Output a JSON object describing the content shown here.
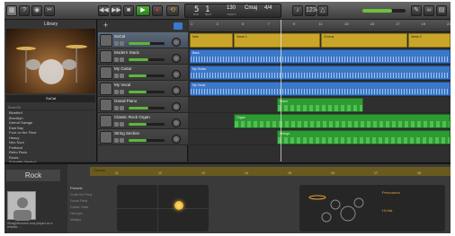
{
  "toolbar": {
    "lcd": {
      "bar": "5",
      "beat": "1",
      "tempo": "130",
      "key": "Cmaj",
      "time_sig": "4/4",
      "bar_caption": "BAR",
      "beat_caption": "BEAT",
      "tempo_caption": "TEMPO"
    }
  },
  "library": {
    "title": "Library",
    "selected_name": "SoCal",
    "section": "Drum Kit",
    "items": [
      "Bluebird",
      "Brooklyn",
      "Detroit Garage",
      "East Bay",
      "Four on the Floor",
      "Heavy",
      "Neo Soul",
      "Portland",
      "Retro Rock",
      "Roots",
      "Scientific Method",
      "Slow Jam",
      "Smash",
      "SoCal",
      "Sunset"
    ],
    "selected_index": 13
  },
  "tracks": [
    {
      "name": "SoCal",
      "volume": 0.6,
      "selected": true
    },
    {
      "name": "Modern Stack",
      "volume": 0.55
    },
    {
      "name": "My Guitar",
      "volume": 0.5
    },
    {
      "name": "My Vocal",
      "volume": 0.5
    },
    {
      "name": "Grand Piano",
      "volume": 0.55
    },
    {
      "name": "Classic Rock Organ",
      "volume": 0.5
    },
    {
      "name": "String Section",
      "volume": 0.5
    }
  ],
  "ruler": [
    "1",
    "3",
    "5",
    "7",
    "9",
    "11",
    "13",
    "15",
    "17",
    "19",
    "21"
  ],
  "regions": {
    "intro": "Intro",
    "verse1": "Verse 1",
    "chorus": "Chorus",
    "verse2": "Verse 2",
    "bass": "Bass",
    "guitar": "My Guitar",
    "vocal": "My Vocal",
    "piano": "Piano",
    "organ": "Organ",
    "strings": "Strings"
  },
  "editor": {
    "instrument": "Rock",
    "region_label": "Chorus",
    "ruler": [
      "11",
      "12",
      "13",
      "14",
      "15",
      "16",
      "17",
      "18"
    ],
    "presets_header": "Presets",
    "presets": [
      "Crash the Party",
      "Fourth Party",
      "Golden State",
      "Half-pipe",
      "Mixtape"
    ],
    "description": "Straightforward rock played on a reliable, ...",
    "kit_labels": {
      "percussion": "Percussion",
      "hihat": "Hi-Hat"
    }
  }
}
